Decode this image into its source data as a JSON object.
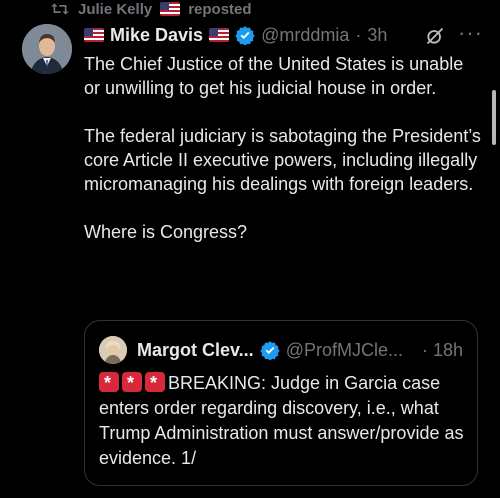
{
  "repost": {
    "user": "Julie Kelly",
    "label": "reposted"
  },
  "post": {
    "author_name": "Mike Davis",
    "handle": "@mrddmia",
    "time": "3h",
    "paragraphs": [
      "The Chief Justice of the United States is unable or unwilling to get his judicial house in order.",
      "The federal judiciary is sabotaging the President’s core Article II executive powers, including illegally micromanaging his dealings with foreign leaders.",
      "Where is Congress?"
    ]
  },
  "quote": {
    "author_name": "Margot Clev...",
    "handle": "@ProfMJCle...",
    "time": "· 18h",
    "text": "BREAKING: Judge in Garcia case enters order regarding discovery, i.e., what Trump Administration must answer/provide as evidence. 1/"
  },
  "icons": {
    "repost": "repost-icon",
    "verified": "verified-badge-icon",
    "grok": "grok-icon",
    "more": "more-icon",
    "flag": "us-flag-icon",
    "siren": "rotating-light-icon"
  },
  "colors": {
    "background": "#000000",
    "text": "#e7e9ea",
    "muted": "#71767b",
    "verified": "#1d9bf0",
    "border": "#2f3336"
  }
}
